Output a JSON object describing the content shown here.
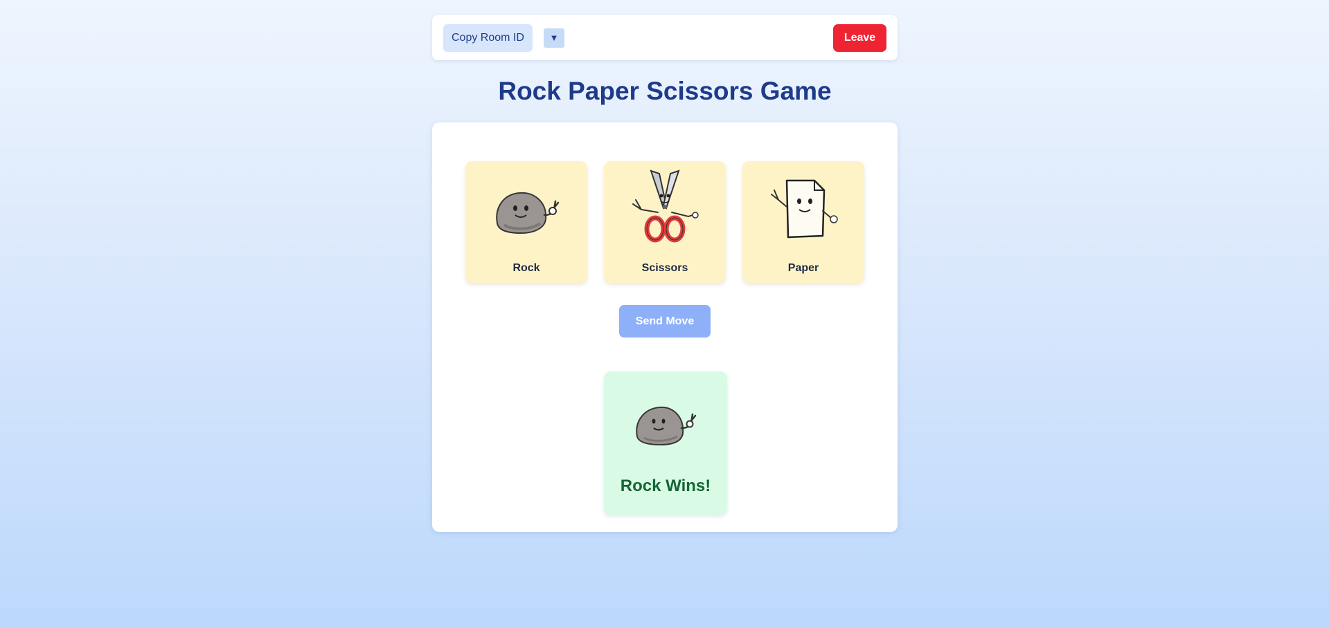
{
  "topbar": {
    "copy_room_label": "Copy Room ID",
    "dropdown_glyph": "▼",
    "leave_label": "Leave"
  },
  "title": "Rock Paper Scissors Game",
  "choices": [
    {
      "label": "Rock",
      "icon": "rock-character-icon"
    },
    {
      "label": "Scissors",
      "icon": "scissors-character-icon"
    },
    {
      "label": "Paper",
      "icon": "paper-character-icon"
    }
  ],
  "send_label": "Send Move",
  "result": {
    "icon": "rock-character-icon",
    "text": "Rock Wins!"
  },
  "colors": {
    "accent": "#1e3a8a",
    "leave": "#ef2433",
    "send": "#8eb0f8",
    "choice_bg": "#fef3c7",
    "result_bg": "#d9fbe6",
    "result_text": "#166534"
  }
}
